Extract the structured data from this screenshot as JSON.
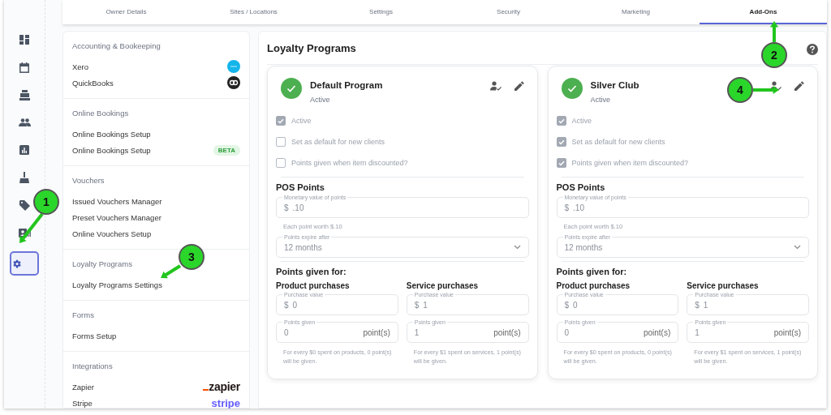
{
  "nav_items": [
    {
      "kind": "dashboard",
      "selected": false
    },
    {
      "kind": "calendar",
      "selected": false
    },
    {
      "kind": "register",
      "selected": false
    },
    {
      "kind": "people",
      "selected": false
    },
    {
      "kind": "chart",
      "selected": false
    },
    {
      "kind": "broom",
      "selected": false
    },
    {
      "kind": "tag",
      "selected": false
    },
    {
      "kind": "card",
      "selected": false
    },
    {
      "kind": "gear",
      "selected": true
    }
  ],
  "tabs": [
    {
      "label": "Owner Details",
      "selected": false
    },
    {
      "label": "Sites / Locations",
      "selected": false
    },
    {
      "label": "Settings",
      "selected": false
    },
    {
      "label": "Security",
      "selected": false
    },
    {
      "label": "Marketing",
      "selected": false
    },
    {
      "label": "Add-Ons",
      "selected": true
    }
  ],
  "sidebar": {
    "sections": [
      {
        "heading": "Accounting & Bookeeping",
        "items": [
          {
            "label": "Xero",
            "logo": {
              "kind": "xero"
            }
          },
          {
            "label": "QuickBooks",
            "logo": {
              "kind": "quickbooks"
            }
          }
        ]
      },
      {
        "heading": "Online Bookings",
        "items": [
          {
            "label": "Online Bookings Setup"
          },
          {
            "label": "Online Bookings Setup",
            "badge": "BETA"
          }
        ]
      },
      {
        "heading": "Vouchers",
        "items": [
          {
            "label": "Issued Vouchers Manager"
          },
          {
            "label": "Preset Vouchers Manager"
          },
          {
            "label": "Online Vouchers Setup"
          }
        ]
      },
      {
        "heading": "Loyalty Programs",
        "items": [
          {
            "label": "Loyalty Programs Settings"
          }
        ]
      },
      {
        "heading": "Forms",
        "items": [
          {
            "label": "Forms Setup"
          }
        ]
      },
      {
        "heading": "Integrations",
        "items": [
          {
            "label": "Zapier",
            "logo": {
              "kind": "zapier",
              "text": "zapier"
            }
          },
          {
            "label": "Stripe",
            "logo": {
              "kind": "stripe",
              "text": "stripe"
            }
          }
        ]
      }
    ]
  },
  "main": {
    "title": "Loyalty Programs",
    "programs": [
      {
        "name": "Default Program",
        "status": "Active",
        "options": [
          {
            "label": "Active",
            "checked": true
          },
          {
            "label": "Set as default for new clients",
            "checked": false
          },
          {
            "label": "Points given when item discounted?",
            "checked": false
          }
        ],
        "pos_heading": "POS Points",
        "monetary": {
          "label": "Monetary value of points",
          "prefix": "$",
          "value": ".10"
        },
        "monetary_hint": "Each point worth $.10",
        "expire": {
          "label": "Points expire after",
          "value": "12 months"
        },
        "given_heading": "Points given for:",
        "groups": [
          {
            "heading": "Product purchases",
            "purchase": {
              "label": "Purchase value",
              "prefix": "$",
              "value": "0"
            },
            "points": {
              "label": "Points given",
              "value": "0",
              "suffix": "point(s)"
            },
            "note": "For every $0 spent on products, 0 point(s) will be given."
          },
          {
            "heading": "Service purchases",
            "purchase": {
              "label": "Purchase value",
              "prefix": "$",
              "value": "1"
            },
            "points": {
              "label": "Points given",
              "value": "1",
              "suffix": "point(s)"
            },
            "note": "For every $1 spent on services, 1 point(s) will be given."
          }
        ]
      },
      {
        "name": "Silver Club",
        "status": "Active",
        "options": [
          {
            "label": "Active",
            "checked": true
          },
          {
            "label": "Set as default for new clients",
            "checked": true
          },
          {
            "label": "Points given when item discounted?",
            "checked": true
          }
        ],
        "pos_heading": "POS Points",
        "monetary": {
          "label": "Monetary value of points",
          "prefix": "$",
          "value": ".10"
        },
        "monetary_hint": "Each point worth $.10",
        "expire": {
          "label": "Points expire after",
          "value": "12 months"
        },
        "given_heading": "Points given for:",
        "groups": [
          {
            "heading": "Product purchases",
            "purchase": {
              "label": "Purchase value",
              "prefix": "$",
              "value": "0"
            },
            "points": {
              "label": "Points given",
              "value": "0",
              "suffix": "point(s)"
            },
            "note": "For every $0 spent on products, 0 point(s) will be given."
          },
          {
            "heading": "Service purchases",
            "purchase": {
              "label": "Purchase value",
              "prefix": "$",
              "value": "1"
            },
            "points": {
              "label": "Points given",
              "value": "1",
              "suffix": "point(s)"
            },
            "note": "For every $1 spent on services, 1 point(s) will be given."
          }
        ]
      }
    ]
  },
  "callouts": [
    {
      "number": "1"
    },
    {
      "number": "2"
    },
    {
      "number": "3"
    },
    {
      "number": "4"
    }
  ]
}
